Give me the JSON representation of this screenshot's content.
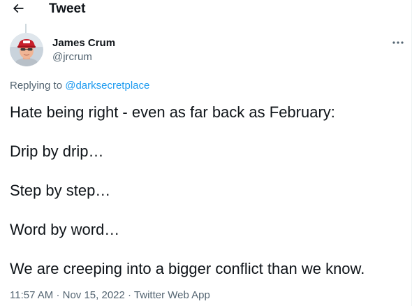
{
  "header": {
    "back_icon": "arrow-left-icon",
    "title": "Tweet"
  },
  "author": {
    "name": "James Crum",
    "handle": "@jrcrum",
    "avatar_icon": "profile-photo"
  },
  "more_icon": "more-horizontal-icon",
  "replying": {
    "prefix": "Replying to",
    "target": "@darksecretplace"
  },
  "tweet": {
    "lines": [
      "Hate being right - even as far back as February:",
      "Drip by drip…",
      "Step by step…",
      "Word by word…",
      "We are creeping into a bigger conflict than we know."
    ]
  },
  "meta": {
    "time": "11:57 AM",
    "separator": "·",
    "date": "Nov 15, 2022",
    "source": "Twitter Web App"
  },
  "colors": {
    "text": "#0f1419",
    "secondary": "#536471",
    "link": "#1d9bf0",
    "divider": "#cfd9de"
  }
}
